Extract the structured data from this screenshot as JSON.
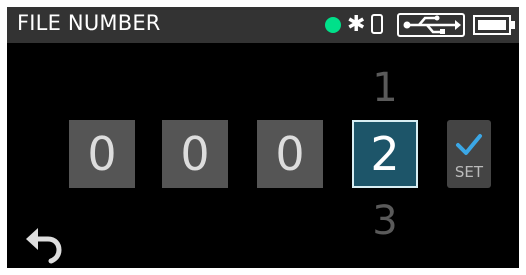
{
  "header": {
    "title": "FILE NUMBER",
    "status": {
      "connection_dot_color": "#00e08a",
      "bluetooth_icon": "✱",
      "icons": [
        "connection-dot-icon",
        "bluetooth-icon",
        "phone-icon",
        "usb-icon",
        "battery-icon"
      ]
    }
  },
  "file_number": {
    "digits": [
      "0",
      "0",
      "0",
      "2"
    ],
    "active_index": 3,
    "previous_value": "1",
    "next_value": "3"
  },
  "set_button": {
    "label": "SET",
    "accent_color": "#3ba7e6"
  },
  "colors": {
    "active_digit_bg": "#1d5569",
    "digit_bg": "#555555"
  }
}
